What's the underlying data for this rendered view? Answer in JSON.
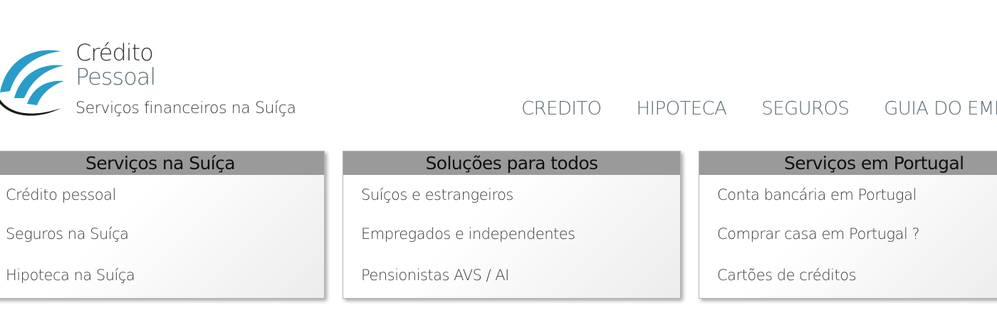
{
  "logo": {
    "line1": "Crédito",
    "line2": "Pessoal",
    "tagline": "Serviços financeiros na Suíça"
  },
  "nav": {
    "items": [
      {
        "label": "CREDITO"
      },
      {
        "label": "HIPOTECA"
      },
      {
        "label": "SEGUROS"
      },
      {
        "label": "GUIA DO EMIGRANTE"
      }
    ]
  },
  "colors": {
    "logo_arc_blue": "#2a9cc8",
    "logo_arc_dark": "#1a1a1a",
    "nav_text": "#5a6c78",
    "panel_header_bg": "#9a9a9a"
  },
  "panels": [
    {
      "title": "Serviços na Suíça",
      "links": [
        "Crédito pessoal",
        "Seguros na Suíça",
        "Hipoteca na Suíça"
      ]
    },
    {
      "title": "Soluções para todos",
      "links": [
        "Suíços e estrangeiros",
        "Empregados e independentes",
        "Pensionistas AVS / AI"
      ]
    },
    {
      "title": "Serviços em Portugal",
      "links": [
        "Conta bancária em Portugal",
        "Comprar casa em Portugal ?",
        "Cartões de créditos"
      ]
    }
  ]
}
